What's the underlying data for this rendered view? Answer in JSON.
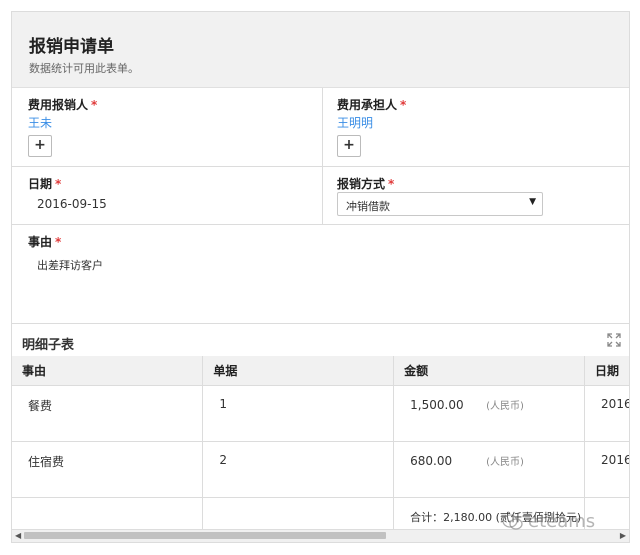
{
  "form": {
    "title": "报销申请单",
    "subtitle": "数据统计可用此表单。"
  },
  "fields": {
    "claimant": {
      "label": "费用报销人",
      "required_mark": "*",
      "value": "王未",
      "add_label": "+"
    },
    "bearer": {
      "label": "费用承担人",
      "required_mark": "*",
      "value": "王明明",
      "add_label": "+"
    },
    "date": {
      "label": "日期",
      "required_mark": "*",
      "value": "2016-09-15"
    },
    "method": {
      "label": "报销方式",
      "required_mark": "*",
      "value": "冲销借款",
      "caret": "▼"
    },
    "reason": {
      "label": "事由",
      "required_mark": "*",
      "value": "出差拜访客户"
    }
  },
  "detail": {
    "title": "明细子表",
    "columns": [
      "事由",
      "单据",
      "金额",
      "日期"
    ],
    "rows": [
      {
        "reason": "餐费",
        "doc": "1",
        "amount": "1,500.00",
        "currency": "(人民币)",
        "date": "2016"
      },
      {
        "reason": "住宿费",
        "doc": "2",
        "amount": "680.00",
        "currency": "(人民币)",
        "date": "2016"
      }
    ],
    "total": "合计：2,180.00 (贰仟壹佰捌拾元)"
  },
  "scrollbar": {
    "left_arrow": "◀",
    "right_arrow": "▶"
  },
  "watermark": {
    "text": "eteams"
  },
  "colors": {
    "accent": "#3a8ee6",
    "required": "#e03b3b",
    "header_bg": "#f1f1f1"
  }
}
